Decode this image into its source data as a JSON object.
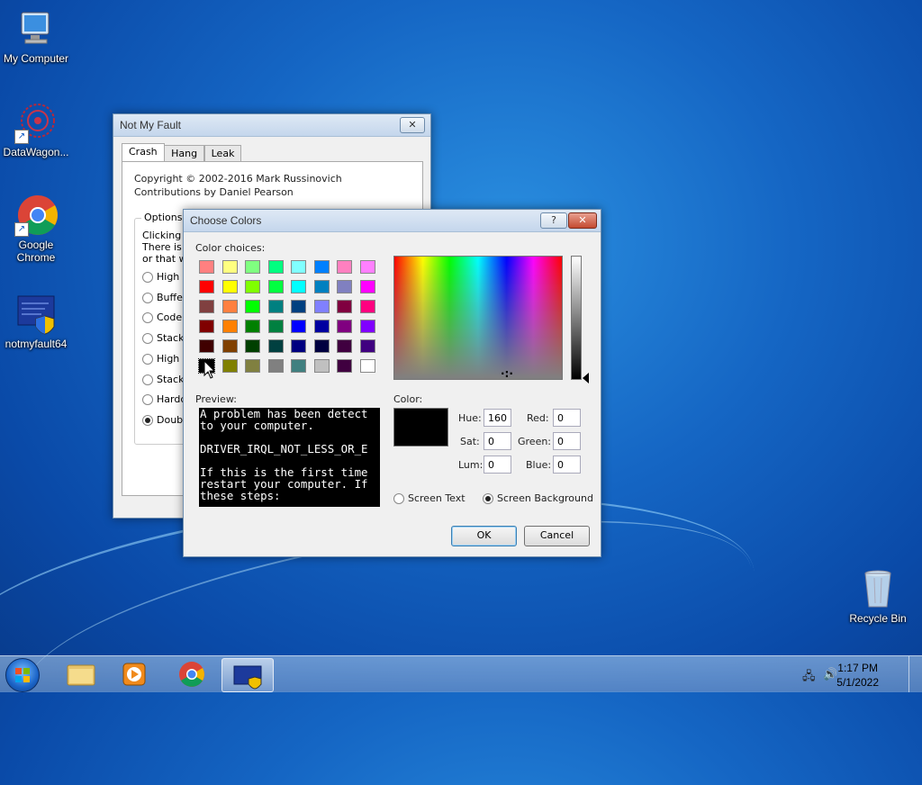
{
  "desktop": {
    "icons": [
      {
        "label": "My Computer"
      },
      {
        "label": "DataWagon..."
      },
      {
        "label": "Google Chrome"
      },
      {
        "label": "notmyfault64"
      },
      {
        "label": "Recycle Bin"
      }
    ]
  },
  "notmyfault": {
    "title": "Not My Fault",
    "close_glyph": "✕",
    "tabs": [
      "Crash",
      "Hang",
      "Leak"
    ],
    "copyright": "Copyright © 2002-2016 Mark Russinovich",
    "contrib": "Contributions by Daniel Pearson",
    "options_label": "Options",
    "desc_lines": [
      "Clicking th",
      "There is a",
      "or that w"
    ],
    "radios": [
      "High I",
      "Buffer",
      "Code o",
      "Stack",
      "High I",
      "Stack",
      "Hardco",
      "Double"
    ],
    "selected_radio": 7
  },
  "colors": {
    "title": "Choose Colors",
    "help_glyph": "?",
    "close_glyph": "✕",
    "choices_label": "Color choices:",
    "swatches": [
      "#ff8080",
      "#ffff80",
      "#80ff80",
      "#00ff80",
      "#80ffff",
      "#0080ff",
      "#ff80c0",
      "#ff80ff",
      "#ff0000",
      "#ffff00",
      "#80ff00",
      "#00ff40",
      "#00ffff",
      "#0080c0",
      "#8080c0",
      "#ff00ff",
      "#804040",
      "#ff8040",
      "#00ff00",
      "#008080",
      "#004080",
      "#8080ff",
      "#800040",
      "#ff0080",
      "#800000",
      "#ff8000",
      "#008000",
      "#008040",
      "#0000ff",
      "#0000a0",
      "#800080",
      "#8000ff",
      "#400000",
      "#804000",
      "#004000",
      "#004040",
      "#000080",
      "#000040",
      "#400040",
      "#400080",
      "#000000",
      "#808000",
      "#808040",
      "#808080",
      "#408080",
      "#c0c0c0",
      "#400040",
      "#ffffff"
    ],
    "selected_swatch": 40,
    "preview_label": "Preview:",
    "preview_text": "A problem has been detect\nto your computer.\n\nDRIVER_IRQL_NOT_LESS_OR_E\n\nIf this is the first time\nrestart your computer. If\nthese steps:",
    "color_label": "Color:",
    "hue_label": "Hue:",
    "hue": "160",
    "sat_label": "Sat:",
    "sat": "0",
    "lum_label": "Lum:",
    "lum": "0",
    "red_label": "Red:",
    "red": "0",
    "green_label": "Green:",
    "green": "0",
    "blue_label": "Blue:",
    "blue": "0",
    "radio_text": "Screen Text",
    "radio_bg": "Screen Background",
    "selected_target": "Screen Background",
    "current_color": "#000000",
    "ok": "OK",
    "cancel": "Cancel"
  },
  "taskbar": {
    "time": "1:17 PM",
    "date": "5/1/2022",
    "items": [
      "windows-explorer",
      "media-player",
      "google-chrome",
      "notmyfault64"
    ],
    "active_item": "notmyfault64"
  }
}
